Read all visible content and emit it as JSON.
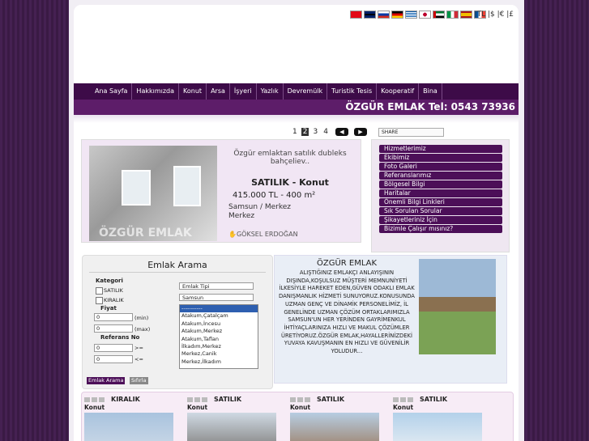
{
  "currency": "|TL |$ |€ |£",
  "flags": [
    "tr",
    "uk",
    "ru",
    "de",
    "gr",
    "jp",
    "ae",
    "it",
    "es",
    "fr"
  ],
  "nav": [
    "Ana Sayfa",
    "Hakkımızda",
    "Konut",
    "Arsa",
    "İşyeri",
    "Yazlık",
    "Devremülk",
    "Turistik Tesis",
    "Kooperatif",
    "Bina"
  ],
  "brand": {
    "name": "ÖZGÜR EMLAK",
    "tel": "Tel: 0543 73936"
  },
  "pager": {
    "pages": [
      "1",
      "2",
      "3",
      "4"
    ],
    "active": "2"
  },
  "share_label": "SHARE",
  "listing": {
    "desc": "Özgür emlaktan satılık dubleks bahçeliev..",
    "type": "SATILIK - Konut",
    "price": "415.000 TL  -  400 m²",
    "loc1": "Samsun / Merkez",
    "loc2": "Merkez",
    "agent": "GÖKSEL ERDOĞAN",
    "watermark": "ÖZGÜR EMLAK"
  },
  "menu": [
    "Hizmetlerimiz",
    "Ekibimiz",
    "Foto Galeri",
    "Referanslarımız",
    "Bölgesel Bilgi",
    "Haritalar",
    "Önemli Bilgi Linkleri",
    "Sık Sorulan Sorular",
    "Şikayetleriniz İçin",
    "Bizimle Çalışır mısınız?"
  ],
  "search": {
    "title": "Emlak Arama",
    "kategori": "Kategori",
    "satilik": "SATILIK",
    "kiralik": "KIRALIK",
    "fiyat": "Fiyat",
    "min": "(min)",
    "max": "(max)",
    "ref": "Referans No",
    "gte": ">=",
    "lte": "<=",
    "zero": "0",
    "type_select": "Emlak Tipi",
    "city_select": "Samsun",
    "districts": [
      "-----------",
      "Atakum,Çatalçam",
      "Atakum,İncesu",
      "Atakum,Merkez",
      "Atakum,Taflan",
      "İlkadım,Merkez",
      "Merkez,Canik",
      "Merkez,İlkadım"
    ],
    "search_btn": "Emlak Arama",
    "reset_btn": "Sıfırla"
  },
  "about": {
    "title": "ÖZGÜR EMLAK",
    "text": "ALIŞTIĞINIZ EMLAKÇI ANLAYIŞININ DIŞINDA,KOŞULSUZ MÜŞTERİ MEMNUNİYETİ İLKESİYLE HAREKET EDEN,GÜVEN ODAKLI EMLAK DANIŞMANLIK HİZMETİ SUNUYORUZ.KONUSUNDA UZMAN GENÇ VE DİNAMİK PERSONELİMİZ, İL GENELİNDE UZMAN ÇÖZÜM ORTAKLARIMIZLA SAMSUN'UN HER YERİNDEN GAYRİMENKUL İHTİYAÇLARINIZA HIZLI VE MAKUL ÇÖZÜMLER ÜRETİYORUZ.ÖZGÜR EMLAK,HAYALLERİNİZDEKİ YUVAYA KAVUŞMANIN EN HIZLI VE GÜVENİLİR YOLUDUR..."
  },
  "cards": [
    {
      "status": "KIRALIK",
      "type": "Konut"
    },
    {
      "status": "SATILIK",
      "type": "Konut"
    },
    {
      "status": "SATILIK",
      "type": "Konut"
    },
    {
      "status": "SATILIK",
      "type": "Konut"
    }
  ]
}
